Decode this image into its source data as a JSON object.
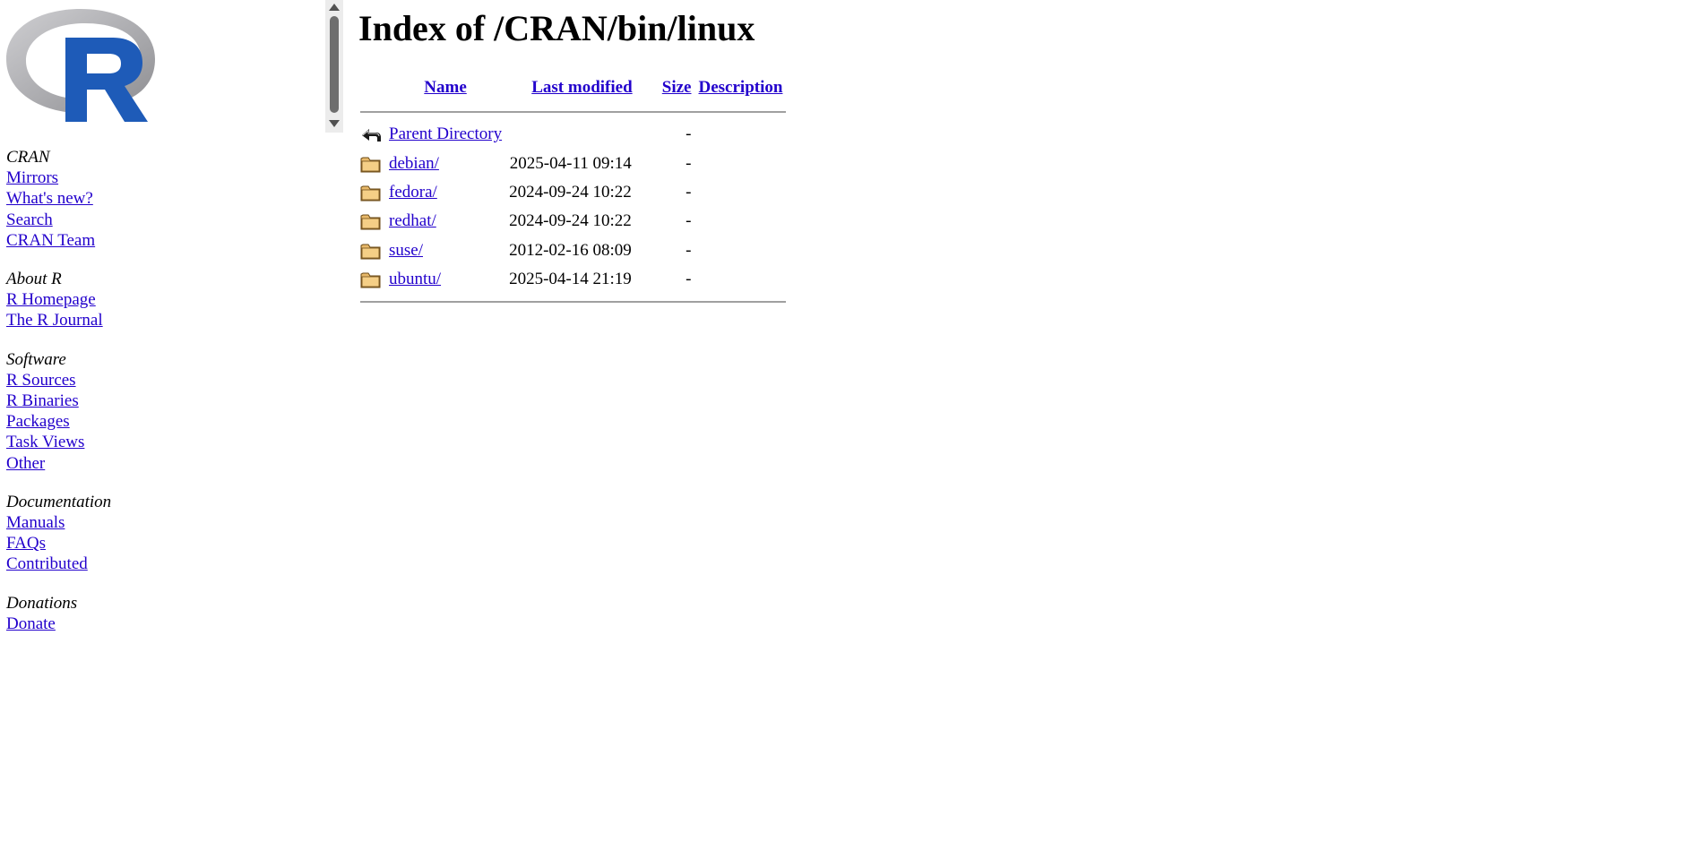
{
  "sidebar": {
    "sections": [
      {
        "heading": "CRAN",
        "links": [
          "Mirrors",
          "What's new?",
          "Search",
          "CRAN Team"
        ]
      },
      {
        "heading": "About R",
        "links": [
          "R Homepage",
          "The R Journal"
        ]
      },
      {
        "heading": "Software",
        "links": [
          "R Sources",
          "R Binaries",
          "Packages",
          "Task Views",
          "Other"
        ]
      },
      {
        "heading": "Documentation",
        "links": [
          "Manuals",
          "FAQs",
          "Contributed"
        ]
      },
      {
        "heading": "Donations",
        "links": [
          "Donate"
        ]
      }
    ]
  },
  "main": {
    "title": "Index of /CRAN/bin/linux",
    "columns": {
      "name": "Name",
      "modified": "Last modified",
      "size": "Size",
      "description": "Description"
    },
    "rows": [
      {
        "icon": "back-icon",
        "name": "Parent Directory",
        "modified": "",
        "size": "-"
      },
      {
        "icon": "folder-icon",
        "name": "debian/",
        "modified": "2025-04-11 09:14",
        "size": "-"
      },
      {
        "icon": "folder-icon",
        "name": "fedora/",
        "modified": "2024-09-24 10:22",
        "size": "-"
      },
      {
        "icon": "folder-icon",
        "name": "redhat/",
        "modified": "2024-09-24 10:22",
        "size": "-"
      },
      {
        "icon": "folder-icon",
        "name": "suse/",
        "modified": "2012-02-16 08:09",
        "size": "-"
      },
      {
        "icon": "folder-icon",
        "name": "ubuntu/",
        "modified": "2025-04-14 21:19",
        "size": "-"
      }
    ]
  },
  "colors": {
    "link": "#2200cc",
    "logo_blue": "#1e5bb8",
    "logo_gray": "#a8a8ab",
    "folder": "#e8b96a"
  }
}
